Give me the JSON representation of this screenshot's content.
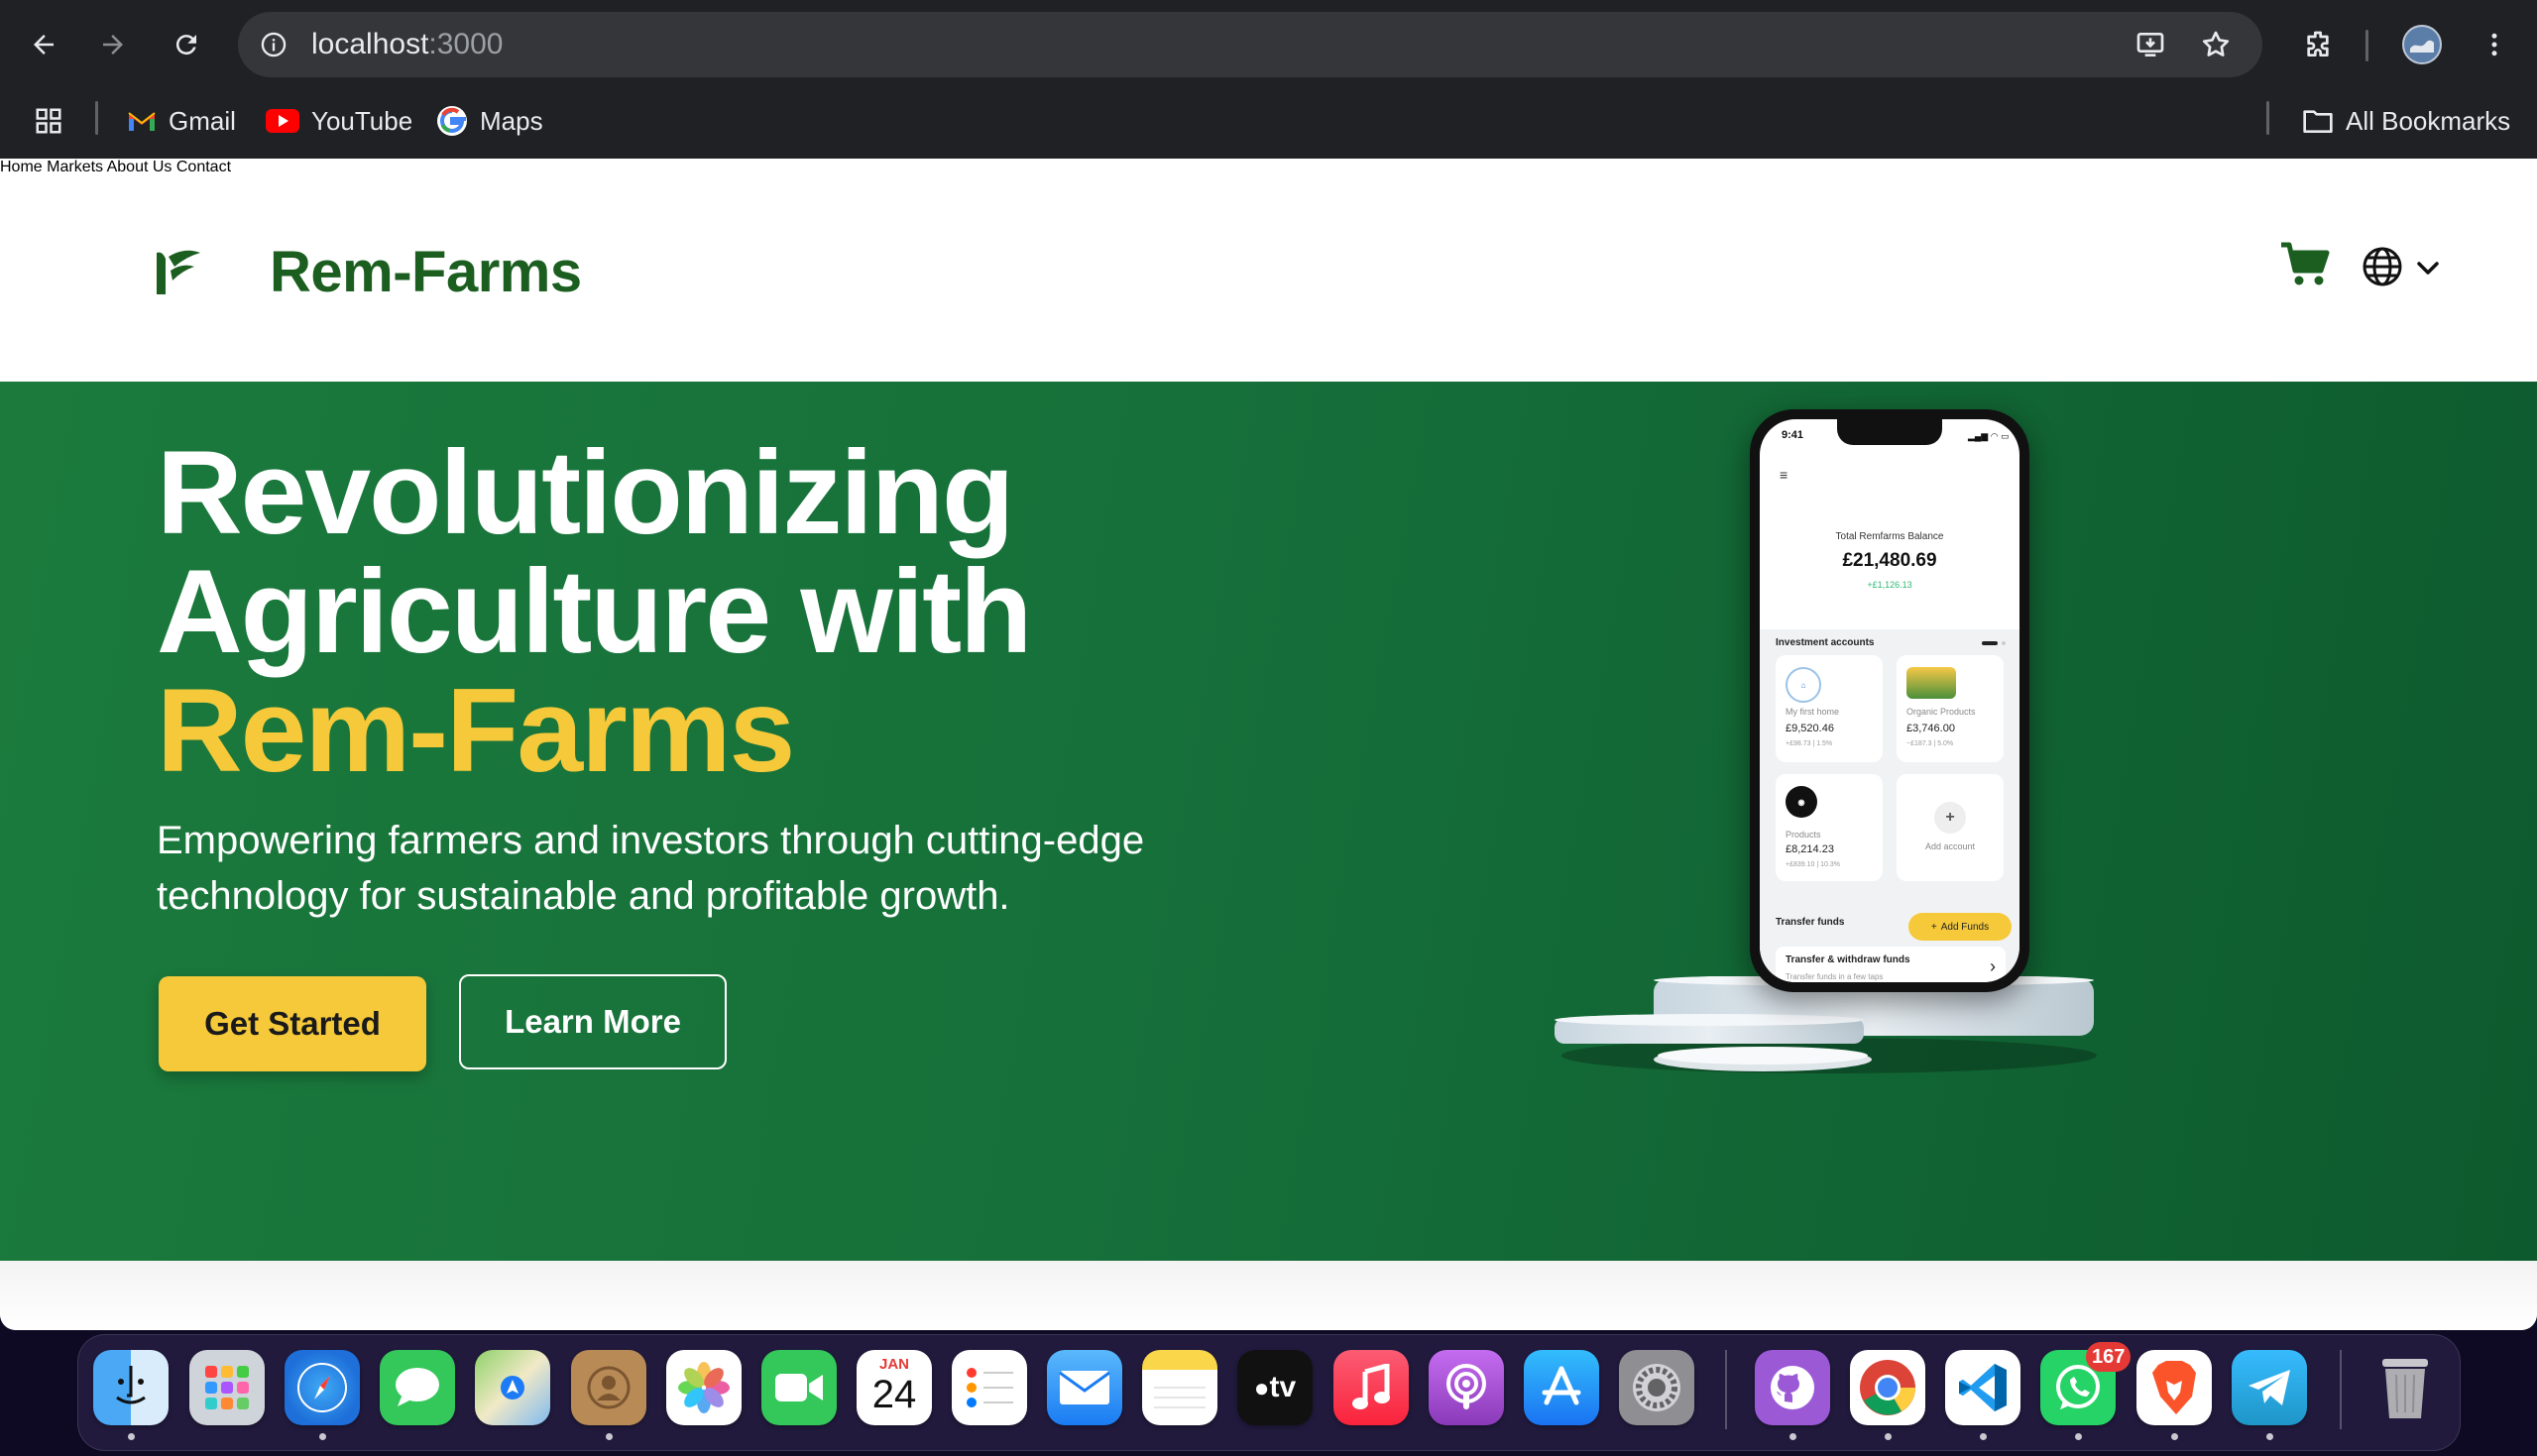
{
  "browser": {
    "url_host": "localhost",
    "url_port": ":3000",
    "bookmarks": [
      {
        "label": "Gmail",
        "icon": "gmail-icon"
      },
      {
        "label": "YouTube",
        "icon": "youtube-icon"
      },
      {
        "label": "Maps",
        "icon": "google-maps-icon"
      }
    ],
    "all_bookmarks_label": "All Bookmarks"
  },
  "site": {
    "brand": "Rem-Farms",
    "nav": [
      "Home",
      "Markets",
      "About Us",
      "Contact"
    ],
    "colors": {
      "brand_green": "#1b5e20",
      "accent_yellow": "#f5c93a",
      "hero_green": "#16703a"
    }
  },
  "hero": {
    "title_line1": "Revolutionizing",
    "title_line2": "Agriculture with",
    "title_accent": "Rem-Farms",
    "subtitle_line1": "Empowering farmers and investors through cutting-edge",
    "subtitle_line2": "technology for sustainable and profitable growth.",
    "primary_button": "Get Started",
    "secondary_button": "Learn More"
  },
  "phone": {
    "time": "9:41",
    "balance_label": "Total Remfarms Balance",
    "balance": "£21,480.69",
    "balance_change": "+£1,126.13",
    "section_title": "Investment accounts",
    "cards": [
      {
        "name": "My first home",
        "value": "£9,520.46",
        "change": "+£98.73 | 1.5%"
      },
      {
        "name": "Organic Products",
        "value": "£3,746.00",
        "change": "−£187.3 | 5.0%"
      },
      {
        "name": "Products",
        "value": "£8,214.23",
        "change": "+£839.10 | 10.3%"
      },
      {
        "name": "Add account",
        "value": "",
        "change": ""
      }
    ],
    "transfer_title": "Transfer funds",
    "add_funds": "Add Funds",
    "withdraw_title": "Transfer & withdraw funds",
    "withdraw_sub": "Transfer funds in a few taps"
  },
  "dock": {
    "apps": [
      {
        "name": "Finder",
        "icon": "finder-icon",
        "running": true
      },
      {
        "name": "Launchpad",
        "icon": "launchpad-icon",
        "running": false
      },
      {
        "name": "Safari",
        "icon": "safari-icon",
        "running": true
      },
      {
        "name": "Messages",
        "icon": "messages-icon",
        "running": false
      },
      {
        "name": "Maps",
        "icon": "maps-icon",
        "running": false
      },
      {
        "name": "Contacts",
        "icon": "contacts-icon",
        "running": true
      },
      {
        "name": "Photos",
        "icon": "photos-icon",
        "running": false
      },
      {
        "name": "FaceTime",
        "icon": "facetime-icon",
        "running": false
      },
      {
        "name": "Calendar",
        "icon": "calendar-icon",
        "running": false,
        "month": "JAN",
        "day": "24"
      },
      {
        "name": "Reminders",
        "icon": "reminders-icon",
        "running": false
      },
      {
        "name": "Mail",
        "icon": "mail-icon",
        "running": false
      },
      {
        "name": "Notes",
        "icon": "notes-icon",
        "running": false
      },
      {
        "name": "TV",
        "icon": "apple-tv-icon",
        "running": false,
        "label": "tv"
      },
      {
        "name": "Music",
        "icon": "music-icon",
        "running": false
      },
      {
        "name": "Podcasts",
        "icon": "podcasts-icon",
        "running": false
      },
      {
        "name": "App Store",
        "icon": "app-store-icon",
        "running": false
      },
      {
        "name": "System Settings",
        "icon": "system-settings-icon",
        "running": false
      },
      {
        "name": "GitHub Desktop",
        "icon": "github-icon",
        "running": true
      },
      {
        "name": "Chrome",
        "icon": "chrome-icon",
        "running": true
      },
      {
        "name": "VS Code",
        "icon": "vscode-icon",
        "running": true
      },
      {
        "name": "WhatsApp",
        "icon": "whatsapp-icon",
        "running": true,
        "badge": "167"
      },
      {
        "name": "Brave",
        "icon": "brave-icon",
        "running": true
      },
      {
        "name": "Telegram",
        "icon": "telegram-icon",
        "running": true
      },
      {
        "name": "Trash",
        "icon": "trash-icon",
        "running": false
      }
    ]
  }
}
